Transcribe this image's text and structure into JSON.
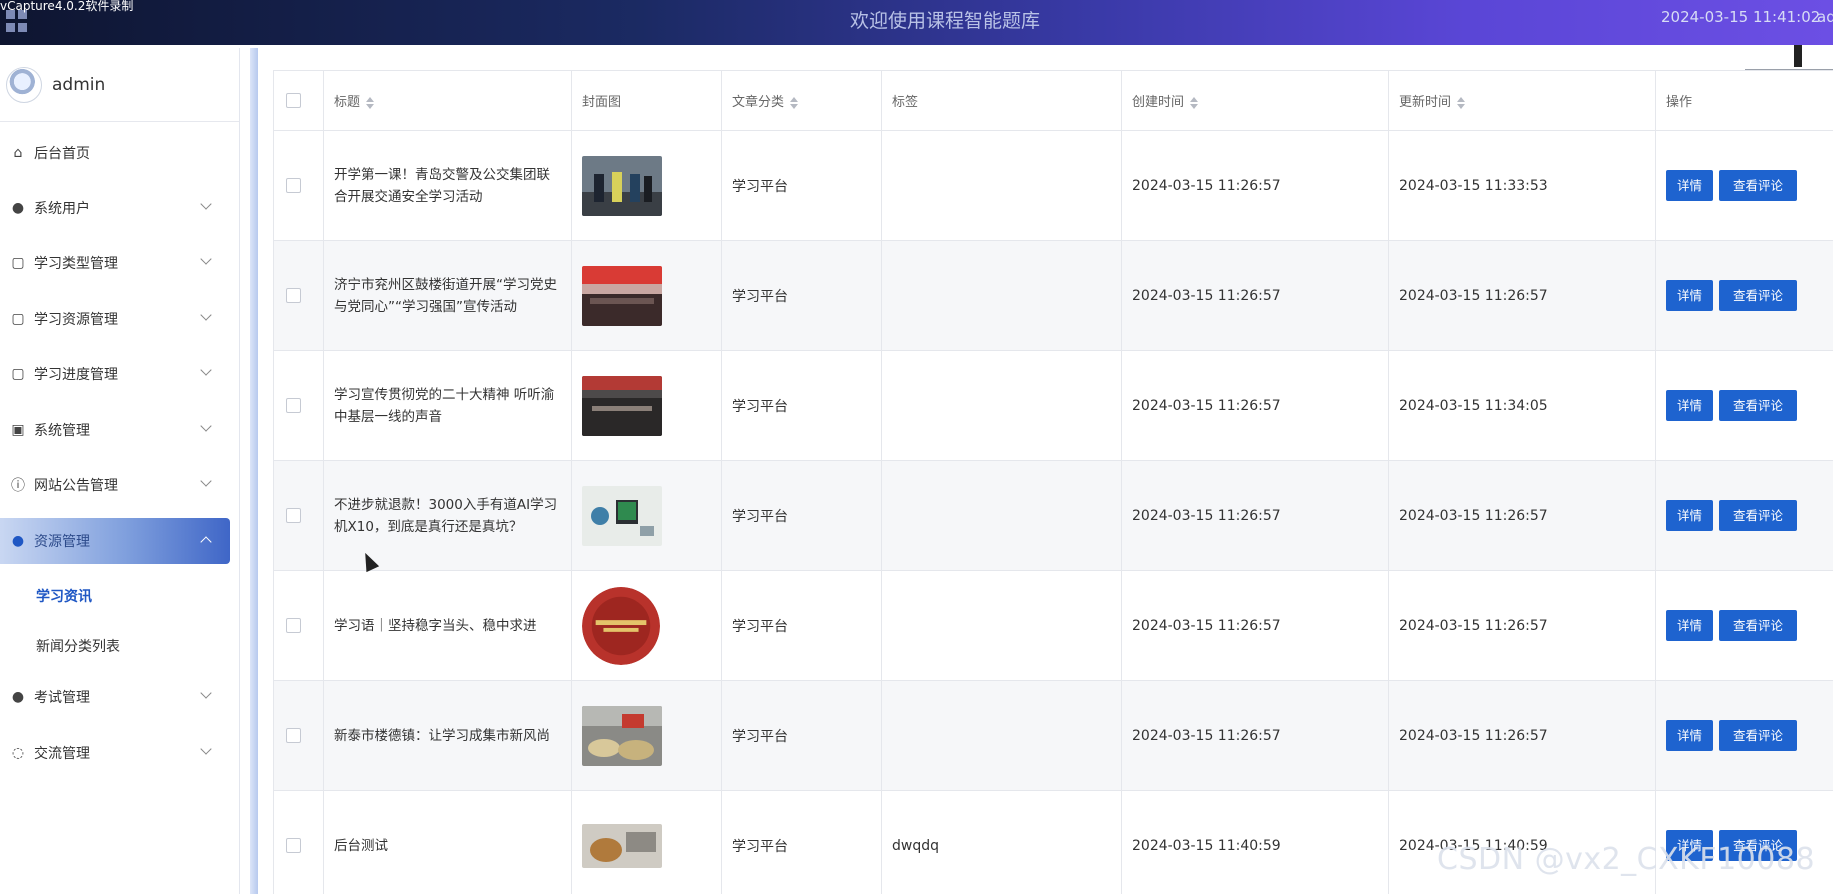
{
  "header": {
    "recorder_text": "vCapture4.0.2软件录制",
    "title": "欢迎使用课程智能题库",
    "datetime": "2024-03-15 11:41:02",
    "user_short": "ad"
  },
  "sidebar": {
    "username": "admin",
    "items": [
      {
        "label": "后台首页",
        "icon": "home-icon"
      },
      {
        "label": "系统用户",
        "icon": "user-icon"
      },
      {
        "label": "学习类型管理",
        "icon": "tag-icon"
      },
      {
        "label": "学习资源管理",
        "icon": "tag-icon"
      },
      {
        "label": "学习进度管理",
        "icon": "tag-icon"
      },
      {
        "label": "系统管理",
        "icon": "image-icon"
      },
      {
        "label": "网站公告管理",
        "icon": "info-icon"
      },
      {
        "label": "资源管理",
        "icon": "bulb-icon"
      },
      {
        "label": "考试管理",
        "icon": "bulb-icon"
      },
      {
        "label": "交流管理",
        "icon": "chat-icon"
      }
    ],
    "submenu": [
      {
        "label": "学习资讯"
      },
      {
        "label": "新闻分类列表"
      }
    ]
  },
  "table": {
    "headers": {
      "title": "标题",
      "cover": "封面图",
      "category": "文章分类",
      "tags": "标签",
      "created": "创建时间",
      "updated": "更新时间",
      "actions": "操作"
    },
    "detail_label": "详情",
    "comment_label": "查看评论",
    "rows": [
      {
        "title": "开学第一课！青岛交警及公交集团联合开展交通安全学习活动",
        "category": "学习平台",
        "tags": "",
        "created": "2024-03-15 11:26:57",
        "updated": "2024-03-15 11:33:53"
      },
      {
        "title": "济宁市兖州区鼓楼街道开展“学习党史 与党同心”“学习强国”宣传活动",
        "category": "学习平台",
        "tags": "",
        "created": "2024-03-15 11:26:57",
        "updated": "2024-03-15 11:26:57"
      },
      {
        "title": "学习宣传贯彻党的二十大精神 听听渝中基层一线的声音",
        "category": "学习平台",
        "tags": "",
        "created": "2024-03-15 11:26:57",
        "updated": "2024-03-15 11:34:05"
      },
      {
        "title": "不进步就退款！3000入手有道AI学习机X10，到底是真行还是真坑？",
        "category": "学习平台",
        "tags": "",
        "created": "2024-03-15 11:26:57",
        "updated": "2024-03-15 11:26:57"
      },
      {
        "title": "学习语｜坚持稳字当头、稳中求进",
        "category": "学习平台",
        "tags": "",
        "created": "2024-03-15 11:26:57",
        "updated": "2024-03-15 11:26:57"
      },
      {
        "title": "新泰市楼德镇：让学习成集市新风尚",
        "category": "学习平台",
        "tags": "",
        "created": "2024-03-15 11:26:57",
        "updated": "2024-03-15 11:26:57"
      },
      {
        "title": "后台测试",
        "category": "学习平台",
        "tags": "dwqdq",
        "created": "2024-03-15 11:40:59",
        "updated": "2024-03-15 11:40:59"
      }
    ]
  },
  "watermark": "CSDN @vx2_CXKF10088",
  "colors": {
    "accent": "#1e63cf",
    "active_menu_text": "#1f57c4"
  }
}
